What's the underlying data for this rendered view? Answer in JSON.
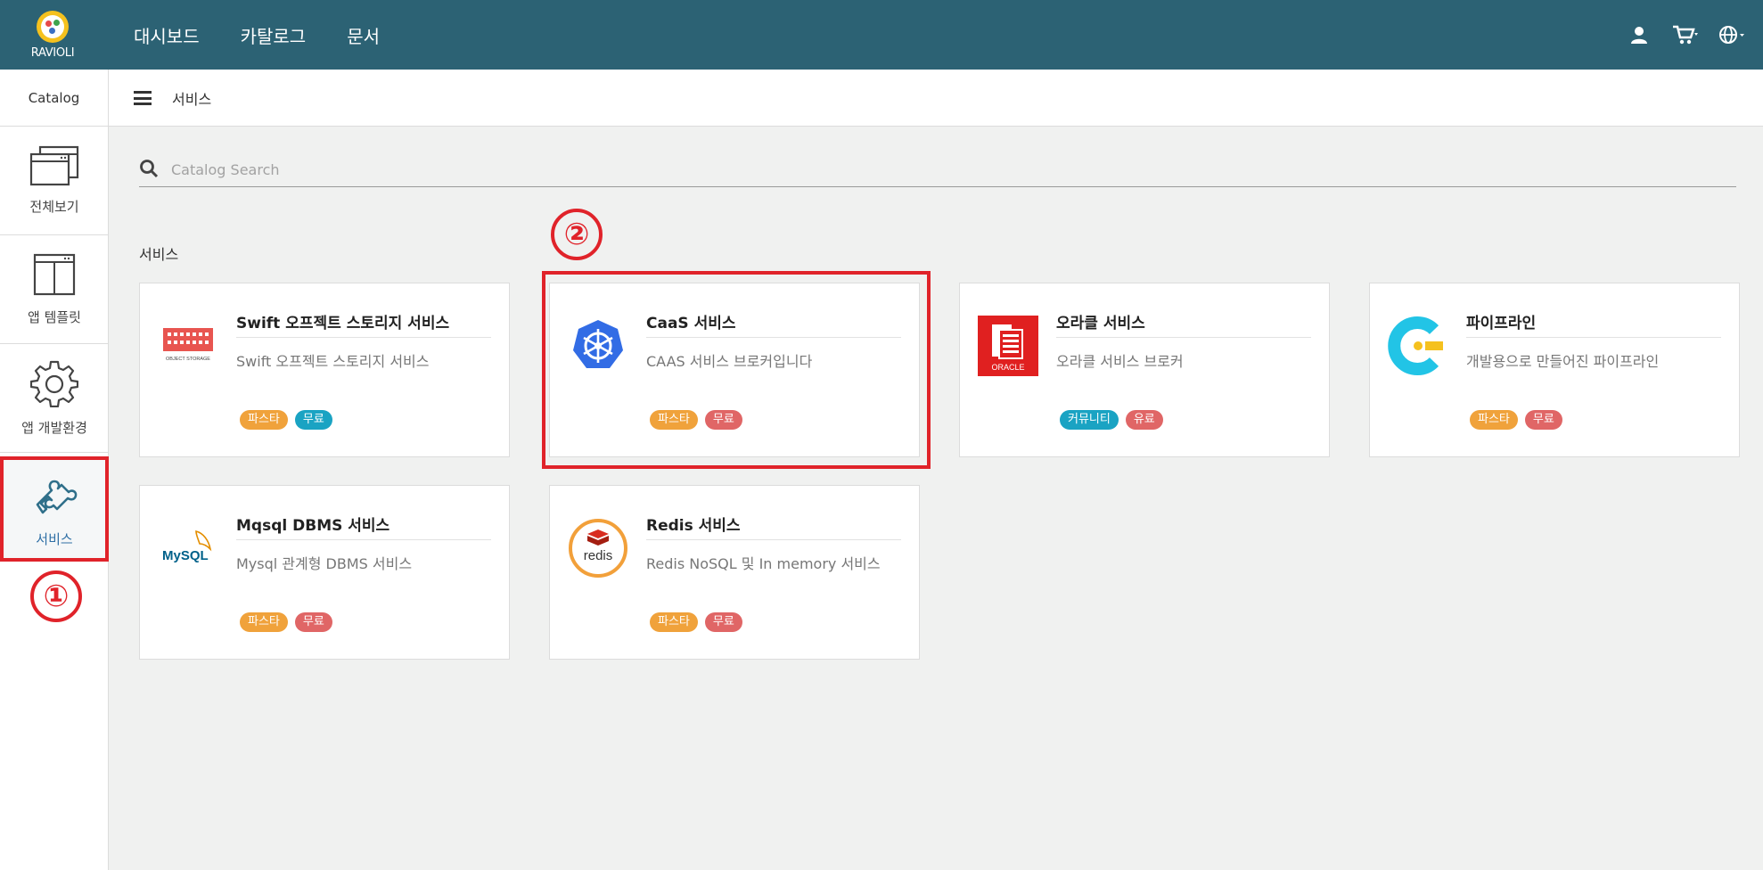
{
  "app": {
    "logo_text": "RAVIOLI"
  },
  "topnav": [
    {
      "label": "대시보드"
    },
    {
      "label": "카탈로그"
    },
    {
      "label": "문서"
    }
  ],
  "header": {
    "left_label": "Catalog",
    "title": "서비스"
  },
  "sidebar": {
    "items": [
      {
        "label": "전체보기",
        "icon": "window-stack-icon"
      },
      {
        "label": "앱 템플릿",
        "icon": "template-layout-icon"
      },
      {
        "label": "앱 개발환경",
        "icon": "gear-icon"
      },
      {
        "label": "서비스",
        "icon": "puzzle-icon",
        "active": true
      }
    ]
  },
  "search": {
    "placeholder": "Catalog Search",
    "value": ""
  },
  "section": {
    "title": "서비스"
  },
  "annotations": {
    "marker_1": "①",
    "marker_2": "②"
  },
  "cards": [
    {
      "title": "Swift 오프젝트 스토리지 서비스",
      "desc": "Swift 오프젝트 스토리지 서비스",
      "icon": "object-storage-icon",
      "icon_text": "OBJECT STORAGE",
      "tags": [
        "파스타",
        "무료"
      ]
    },
    {
      "title": "CaaS 서비스",
      "desc": "CAAS 서비스 브로커입니다",
      "icon": "kubernetes-icon",
      "tags": [
        "파스타",
        "무료"
      ]
    },
    {
      "title": "오라클 서비스",
      "desc": "오라클 서비스 브로커",
      "icon": "oracle-icon",
      "icon_text": "ORACLE",
      "tags": [
        "커뮤니티",
        "유료"
      ]
    },
    {
      "title": "파이프라인",
      "desc": "개발용으로 만들어진 파이프라인",
      "icon": "pipeline-icon",
      "tags": [
        "파스타",
        "무료"
      ]
    },
    {
      "title": "Mqsql DBMS 서비스",
      "desc": "Mysql 관계형 DBMS 서비스",
      "icon": "mysql-icon",
      "icon_text": "MySQL",
      "tags": [
        "파스타",
        "무료"
      ]
    },
    {
      "title": "Redis 서비스",
      "desc": "Redis NoSQL 및 In memory 서비스",
      "icon": "redis-icon",
      "icon_text": "redis",
      "tags": [
        "파스타",
        "무료"
      ]
    }
  ],
  "colors": {
    "topbar": "#2c6274",
    "tag_orange": "#f0a23b",
    "tag_red": "#e06666",
    "tag_teal": "#1aa3c3",
    "annotation_red": "#e0232a"
  }
}
